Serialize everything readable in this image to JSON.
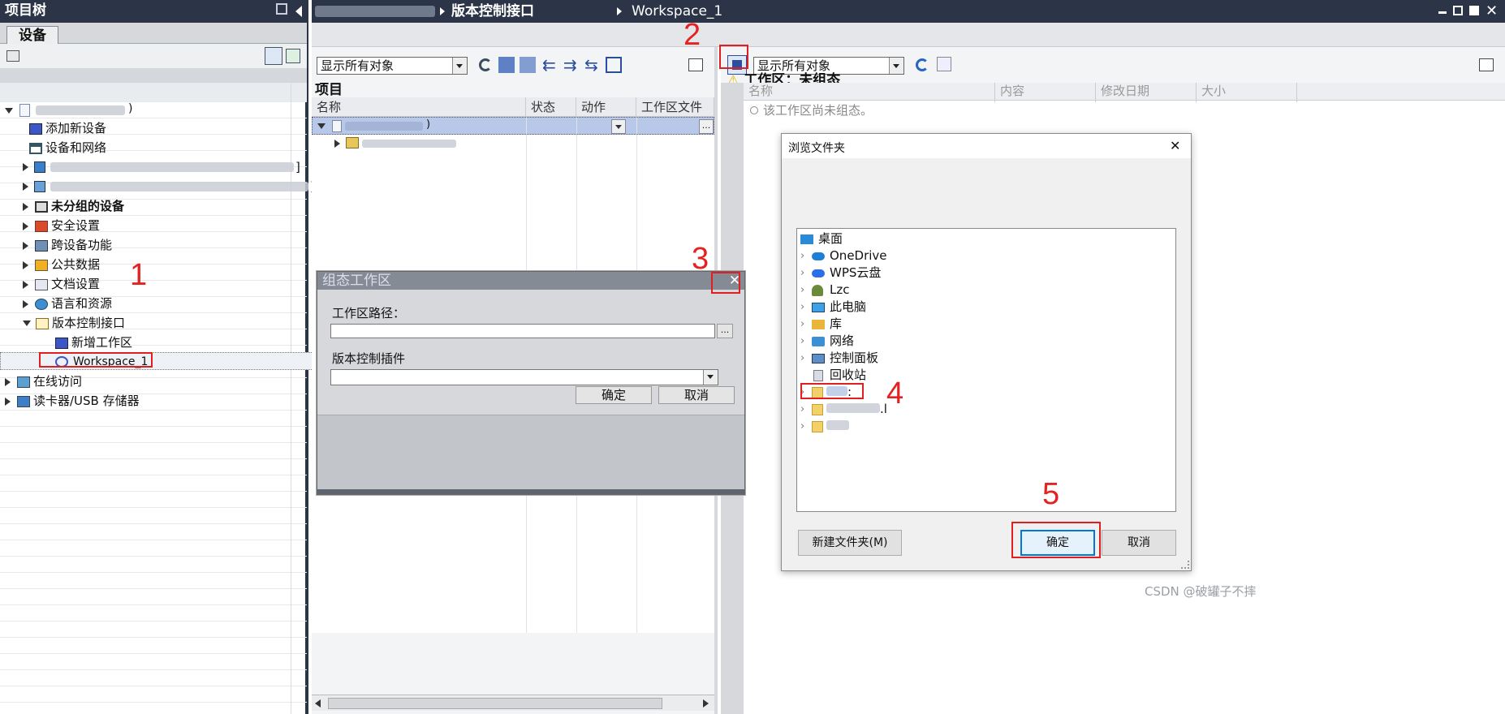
{
  "project_tree": {
    "title": "项目树",
    "tab": "设备",
    "items": [
      {
        "label": "添加新设备"
      },
      {
        "label": "设备和网络"
      },
      {
        "label": "]"
      },
      {
        "label": "]"
      },
      {
        "label": "未分组的设备"
      },
      {
        "label": "安全设置"
      },
      {
        "label": "跨设备功能"
      },
      {
        "label": "公共数据"
      },
      {
        "label": "文档设置"
      },
      {
        "label": "语言和资源"
      },
      {
        "label": "版本控制接口"
      },
      {
        "label": "新增工作区"
      },
      {
        "label": "Workspace_1"
      },
      {
        "label": "在线访问"
      },
      {
        "label": "读卡器/USB 存储器"
      }
    ]
  },
  "main": {
    "breadcrumb": {
      "parent": "版本控制接口",
      "current": "Workspace_1"
    },
    "left_panel": {
      "filter": "显示所有对象",
      "section_title": "项目",
      "columns": [
        "名称",
        "状态",
        "动作",
        "工作区文件"
      ],
      "ellipsis": "..."
    },
    "right_panel": {
      "filter": "显示所有对象",
      "warning_title": "工作区：未组态",
      "columns": [
        "名称",
        "内容",
        "修改日期",
        "大小"
      ],
      "empty_message": "该工作区尚未组态。"
    }
  },
  "configure_dialog": {
    "title": "组态工作区",
    "path_label": "工作区路径：",
    "path_value": "",
    "browse_label": "...",
    "plugin_label": "版本控制插件",
    "plugin_value": "",
    "ok": "确定",
    "cancel": "取消"
  },
  "browse_dialog": {
    "title": "浏览文件夹",
    "close": "✕",
    "folders": [
      {
        "label": "桌面",
        "icon": "desktop-icon"
      },
      {
        "label": "OneDrive",
        "icon": "cloud-icon"
      },
      {
        "label": "WPS云盘",
        "icon": "cloud-icon"
      },
      {
        "label": "Lzc",
        "icon": "user-icon"
      },
      {
        "label": "此电脑",
        "icon": "computer-icon"
      },
      {
        "label": "库",
        "icon": "library-icon"
      },
      {
        "label": "网络",
        "icon": "network-icon"
      },
      {
        "label": "控制面板",
        "icon": "control-panel-icon"
      },
      {
        "label": "回收站",
        "icon": "recycle-bin-icon"
      },
      {
        "label": ":",
        "icon": "folder-icon"
      },
      {
        "label": ".l",
        "icon": "folder-icon"
      },
      {
        "label": "",
        "icon": "folder-icon"
      }
    ],
    "new_folder": "新建文件夹(M)",
    "ok": "确定",
    "cancel": "取消"
  },
  "annotations": [
    "1",
    "2",
    "3",
    "4",
    "5"
  ],
  "watermark": "CSDN @破罐子不摔",
  "colors": {
    "header": "#2b3547",
    "annotation": "#e52121",
    "selection": "#b8c8e8"
  }
}
